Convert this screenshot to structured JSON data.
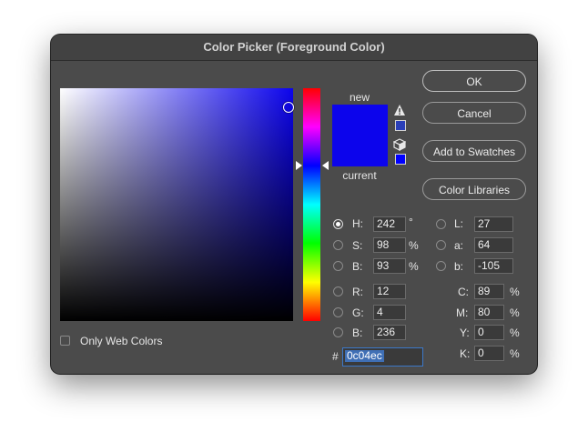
{
  "dialog": {
    "title": "Color Picker (Foreground Color)"
  },
  "colors": {
    "selected": "#0c04ec",
    "gamut_warning": "#2a3fb8",
    "websafe": "#0000ff",
    "dialog_bg": "#4b4b4b"
  },
  "preview": {
    "new_label": "new",
    "current_label": "current"
  },
  "icons": {
    "warning": "warning-triangle-icon",
    "websafe": "cube-icon"
  },
  "buttons": {
    "ok": "OK",
    "cancel": "Cancel",
    "add_swatches": "Add to Swatches",
    "color_libraries": "Color Libraries"
  },
  "hsb": {
    "h": {
      "label": "H:",
      "value": "242",
      "unit": "°"
    },
    "s": {
      "label": "S:",
      "value": "98",
      "unit": "%"
    },
    "b": {
      "label": "B:",
      "value": "93",
      "unit": "%"
    }
  },
  "rgb": {
    "r": {
      "label": "R:",
      "value": "12"
    },
    "g": {
      "label": "G:",
      "value": "4"
    },
    "b": {
      "label": "B:",
      "value": "236"
    }
  },
  "lab": {
    "l": {
      "label": "L:",
      "value": "27"
    },
    "a": {
      "label": "a:",
      "value": "64"
    },
    "b": {
      "label": "b:",
      "value": "-105"
    }
  },
  "cmyk": {
    "c": {
      "label": "C:",
      "value": "89",
      "unit": "%"
    },
    "m": {
      "label": "M:",
      "value": "80",
      "unit": "%"
    },
    "y": {
      "label": "Y:",
      "value": "0",
      "unit": "%"
    },
    "k": {
      "label": "K:",
      "value": "0",
      "unit": "%"
    }
  },
  "hex": {
    "label": "#",
    "value": "0c04ec"
  },
  "web_colors": {
    "label": "Only Web Colors",
    "checked": false
  }
}
